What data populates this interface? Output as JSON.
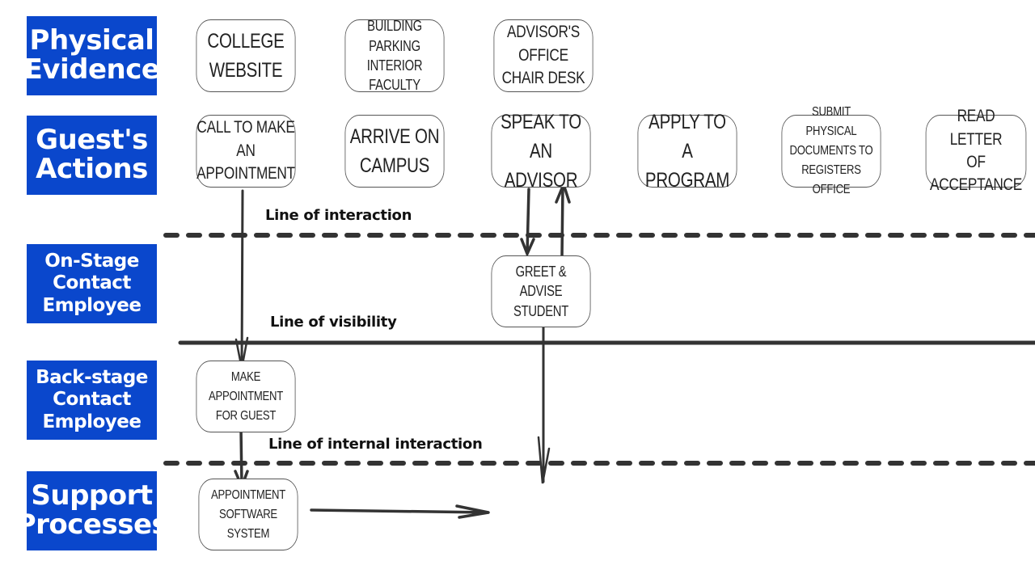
{
  "lanes": [
    {
      "id": "physical-evidence",
      "label": [
        "Physical",
        "Evidence"
      ]
    },
    {
      "id": "guests-actions",
      "label": [
        "Guest's",
        "Actions"
      ]
    },
    {
      "id": "on-stage-contact-employee",
      "label": [
        "On-Stage",
        "Contact",
        "Employee"
      ]
    },
    {
      "id": "back-stage-contact-employee",
      "label": [
        "Back-stage",
        "Contact",
        "Employee"
      ]
    },
    {
      "id": "support-processes",
      "label": [
        "Support",
        "Processes"
      ]
    }
  ],
  "physical_evidence": [
    {
      "text": "COLLEGE\nWEBSITE"
    },
    {
      "text": "BUILDING PARKING\nINTERIOR FACULTY"
    },
    {
      "text": "ADVISOR'S OFFICE\nCHAIR DESK"
    }
  ],
  "guest_actions": [
    {
      "text": "CALL TO MAKE\nAN APPOINTMENT"
    },
    {
      "text": "ARRIVE ON\nCAMPUS"
    },
    {
      "text": "SPEAK TO AN\nADVISOR"
    },
    {
      "text": "APPLY TO A\nPROGRAM"
    },
    {
      "text": "SUBMIT PHYSICAL\nDOCUMENTS TO\nREGISTERS OFFICE"
    },
    {
      "text": "READ LETTER\nOF ACCEPTANCE"
    }
  ],
  "on_stage": [
    {
      "text": "GREET & ADVISE\nSTUDENT"
    }
  ],
  "back_stage": [
    {
      "text": "MAKE APPOINTMENT\nFOR GUEST"
    }
  ],
  "support": [
    {
      "text": "APPOINTMENT\nSOFTWARE SYSTEM"
    }
  ],
  "divider_lines": {
    "interaction": "Line of interaction",
    "visibility": "Line of visibility",
    "internal_interaction": "Line of internal interaction"
  },
  "colors": {
    "lane_label_bg": "#0a47cc",
    "lane_label_text": "#ffffff",
    "line_color": "#333333"
  }
}
